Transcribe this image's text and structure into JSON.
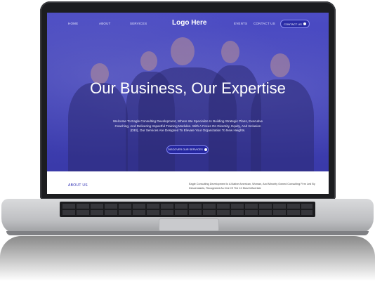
{
  "nav": {
    "items": [
      "HOME",
      "ABOUT",
      "SERVICES",
      "EVENTS",
      "CONTACT US"
    ],
    "logo": "Logo Here",
    "contact_button": "CONTACT US"
  },
  "hero": {
    "headline": "Our Business, Our Expertise",
    "intro": "Welcome To Eagle Consulting Development, Where We Specialize In Building Strategic Plans, Executive Coaching, And Delivering Impactful Training Modules. With A Focus On Diversity, Equity, And Inclusion (DEI), Our Services Are Designed To Elevate Your Organization To New Heights.",
    "cta": "DISCOVER OUR SERVICES"
  },
  "about": {
    "title": "ABOUT US",
    "text": "Eagle Consulting Development Is A Native American, Woman, And Minority Owned Consulting Firm Led By Descendants, Recognized As One Of The 10 Most Influential"
  },
  "colors": {
    "accent": "#4c4cc4",
    "button": "#2a2ca6"
  },
  "icons": [
    "circle-arrow-icon"
  ]
}
